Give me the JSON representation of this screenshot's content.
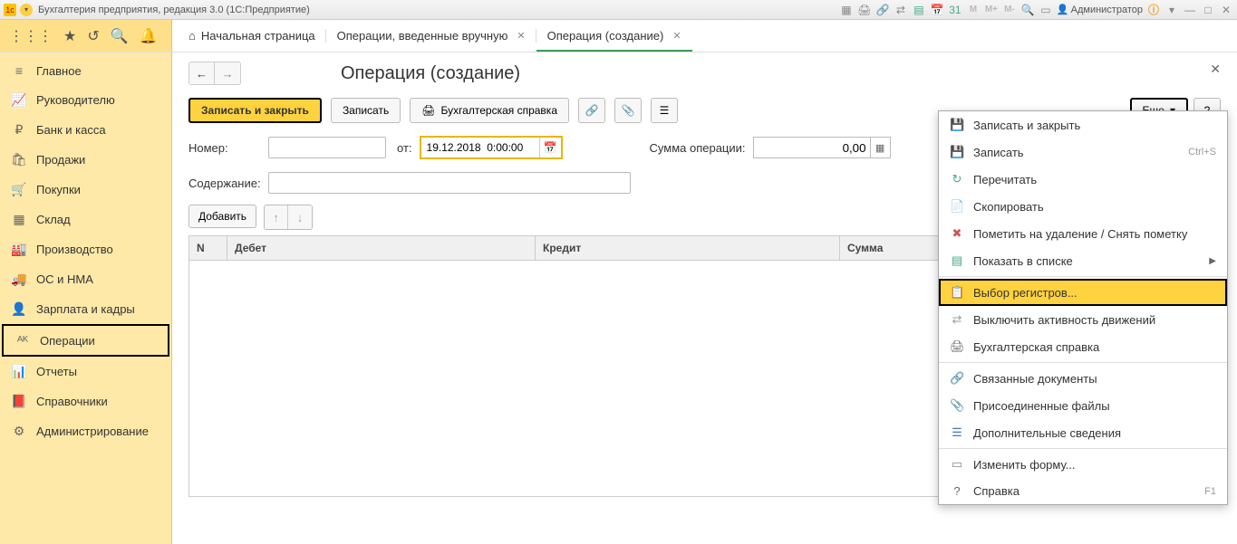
{
  "title": "Бухгалтерия предприятия, редакция 3.0  (1С:Предприятие)",
  "user": "Администратор",
  "toolbar_m": [
    "M",
    "M+",
    "M-"
  ],
  "tabs": [
    {
      "label": "Начальная страница",
      "closable": false,
      "home": true
    },
    {
      "label": "Операции, введенные вручную",
      "closable": true
    },
    {
      "label": "Операция (создание)",
      "closable": true,
      "active": true
    }
  ],
  "sidebar": [
    {
      "icon": "≡",
      "label": "Главное"
    },
    {
      "icon": "📈",
      "label": "Руководителю"
    },
    {
      "icon": "₽",
      "label": "Банк и касса"
    },
    {
      "icon": "🛍",
      "label": "Продажи"
    },
    {
      "icon": "🛒",
      "label": "Покупки"
    },
    {
      "icon": "▦",
      "label": "Склад"
    },
    {
      "icon": "🏭",
      "label": "Производство"
    },
    {
      "icon": "🚚",
      "label": "ОС и НМА"
    },
    {
      "icon": "👤",
      "label": "Зарплата и кадры"
    },
    {
      "icon": "ᴬᴷ",
      "label": "Операции",
      "active": true
    },
    {
      "icon": "📊",
      "label": "Отчеты"
    },
    {
      "icon": "📕",
      "label": "Справочники"
    },
    {
      "icon": "⚙",
      "label": "Администрирование"
    }
  ],
  "page": {
    "heading": "Операция (создание)",
    "btn_save_close": "Записать и закрыть",
    "btn_save": "Записать",
    "btn_report": "Бухгалтерская справка",
    "btn_more": "Еще",
    "lbl_number": "Номер:",
    "lbl_from": "от:",
    "date_value": "19.12.2018  0:00:00",
    "lbl_sum": "Сумма операции:",
    "sum_value": "0,00",
    "lbl_content": "Содержание:",
    "btn_add": "Добавить",
    "grid_headers": {
      "n": "N",
      "debit": "Дебет",
      "credit": "Кредит",
      "sum": "Сумма"
    }
  },
  "menu": [
    {
      "icon": "💾",
      "label": "Записать и закрыть",
      "color": "#4a8"
    },
    {
      "icon": "💾",
      "label": "Записать",
      "hint": "Ctrl+S",
      "color": "#47c"
    },
    {
      "icon": "↻",
      "label": "Перечитать",
      "color": "#4a8"
    },
    {
      "icon": "📄",
      "label": "Скопировать",
      "color": "#4a8"
    },
    {
      "icon": "✖",
      "label": "Пометить на удаление / Снять пометку",
      "color": "#c55"
    },
    {
      "icon": "▤",
      "label": "Показать в списке",
      "arrow": true,
      "color": "#4a8"
    },
    {
      "sep": true
    },
    {
      "icon": "📋",
      "label": "Выбор регистров...",
      "highlight": true,
      "color": "#c90"
    },
    {
      "icon": "⇄",
      "label": "Выключить активность движений",
      "color": "#999"
    },
    {
      "icon": "🖨",
      "label": "Бухгалтерская справка",
      "color": "#666"
    },
    {
      "sep": true
    },
    {
      "icon": "🔗",
      "label": "Связанные документы",
      "color": "#4a8"
    },
    {
      "icon": "📎",
      "label": "Присоединенные файлы",
      "color": "#888"
    },
    {
      "icon": "☰",
      "label": "Дополнительные сведения",
      "color": "#47c"
    },
    {
      "sep": true
    },
    {
      "icon": "▭",
      "label": "Изменить форму...",
      "color": "#888"
    },
    {
      "icon": "?",
      "label": "Справка",
      "hint": "F1",
      "color": "#666"
    }
  ]
}
